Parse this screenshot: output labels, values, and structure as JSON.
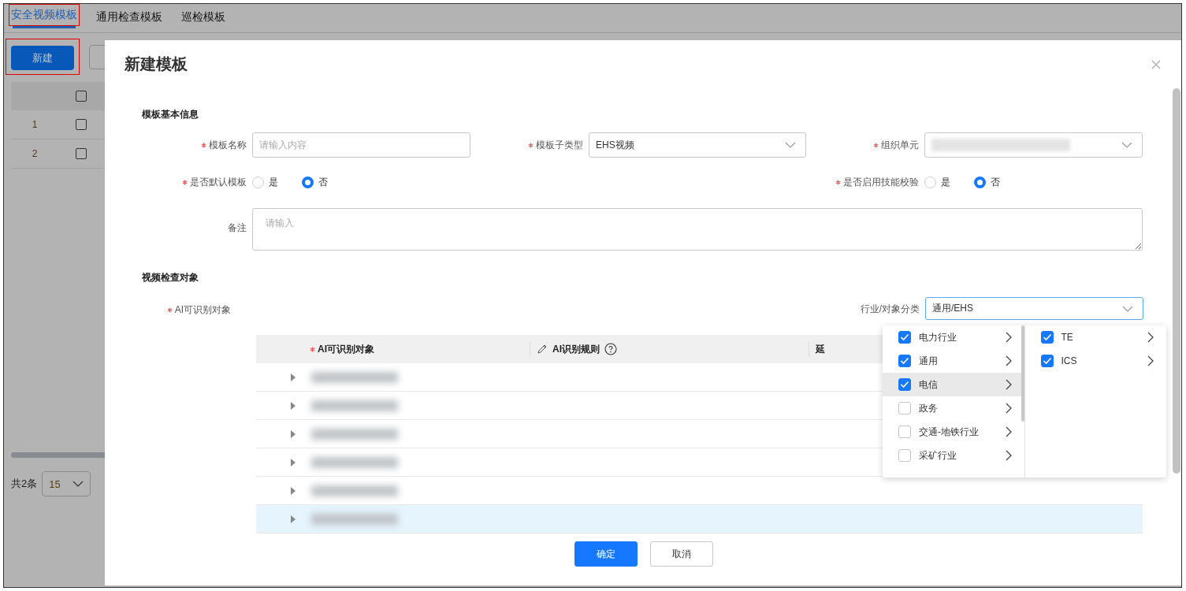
{
  "tabs": [
    {
      "label": "安全视频模板",
      "selected": true,
      "highlighted": true
    },
    {
      "label": "通用检查模板",
      "selected": false,
      "highlighted": false
    },
    {
      "label": "巡检模板",
      "selected": false,
      "highlighted": false
    }
  ],
  "toolbar": {
    "new_button": {
      "label": "新建",
      "highlighted": true
    }
  },
  "table": {
    "header_checked": false,
    "rows": [
      {
        "index": "1",
        "checked": false
      },
      {
        "index": "2",
        "checked": false
      }
    ]
  },
  "pagination": {
    "total": "共2条",
    "page_size": "15"
  },
  "dialog": {
    "title": "新建模板",
    "basic_section": {
      "title": "模板基本信息",
      "name_field": {
        "label": "模板名称",
        "required": true,
        "placeholder": "请输入内容"
      },
      "subtype_field": {
        "label": "模板子类型",
        "required": true,
        "value": "EHS视频"
      },
      "org_field": {
        "label": "组织单元",
        "required": true
      },
      "default_radio": {
        "label": "是否默认模板",
        "required": true,
        "options": [
          {
            "label": "是",
            "selected": false
          },
          {
            "label": "否",
            "selected": true
          }
        ]
      },
      "skill_radio": {
        "label": "是否启用技能校验",
        "required": true,
        "options": [
          {
            "label": "是",
            "selected": false
          },
          {
            "label": "否",
            "selected": true
          }
        ]
      },
      "remark_field": {
        "label": "备注",
        "placeholder": "请输入"
      }
    },
    "objects_section": {
      "title": "视频检查对象",
      "ai_label": {
        "label": "AI可识别对象",
        "required": true
      },
      "category_field": {
        "label": "行业/对象分类",
        "value": "通用/EHS",
        "focused": true
      },
      "columns": [
        {
          "label": "AI可识别对象",
          "required": true,
          "kind": "plain"
        },
        {
          "label": "AI识别规则",
          "required": false,
          "kind": "editable"
        },
        {
          "label": "延",
          "required": false,
          "kind": "plain"
        }
      ],
      "rows": [
        {
          "expanded": false,
          "selected": false
        },
        {
          "expanded": false,
          "selected": false
        },
        {
          "expanded": false,
          "selected": false
        },
        {
          "expanded": false,
          "selected": false
        },
        {
          "expanded": false,
          "selected": false
        },
        {
          "expanded": false,
          "selected": true
        }
      ]
    },
    "cascader": {
      "panels": [
        {
          "items": [
            {
              "label": "电力行业",
              "checked": true,
              "selected": false
            },
            {
              "label": "通用",
              "checked": true,
              "selected": false
            },
            {
              "label": "电信",
              "checked": true,
              "selected": true
            },
            {
              "label": "政务",
              "checked": false,
              "selected": false
            },
            {
              "label": "交通-地铁行业",
              "checked": false,
              "selected": false
            },
            {
              "label": "采矿行业",
              "checked": false,
              "selected": false
            }
          ]
        },
        {
          "items": [
            {
              "label": "TE",
              "checked": true,
              "selected": false
            },
            {
              "label": "ICS",
              "checked": true,
              "selected": false
            }
          ]
        }
      ]
    },
    "buttons": [
      {
        "label": "确定",
        "kind": "primary"
      },
      {
        "label": "取消",
        "kind": "default"
      }
    ]
  }
}
